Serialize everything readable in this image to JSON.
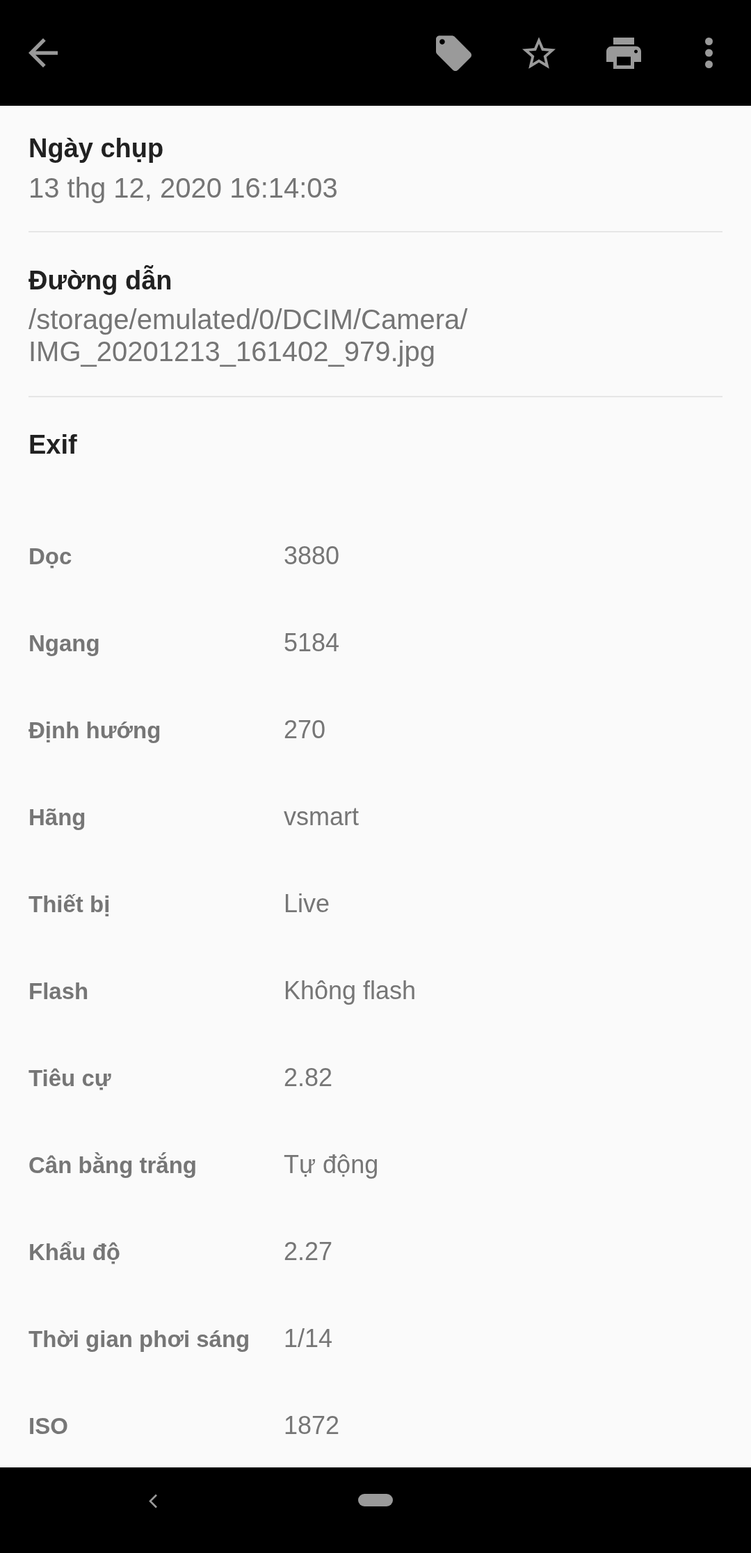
{
  "toolbar": {
    "favorite": false
  },
  "details": [
    {
      "title": "Ngày chụp",
      "value": "13 thg 12, 2020 16:14:03"
    },
    {
      "title": "Đường dẫn",
      "value": "/storage/emulated/0/DCIM/Camera/IMG_20201213_161402_979.jpg"
    }
  ],
  "exif": {
    "title": "Exif",
    "rows": [
      {
        "label": "Dọc",
        "value": "3880"
      },
      {
        "label": "Ngang",
        "value": "5184"
      },
      {
        "label": "Định hướng",
        "value": "270"
      },
      {
        "label": "Hãng",
        "value": "vsmart"
      },
      {
        "label": "Thiết bị",
        "value": "Live"
      },
      {
        "label": "Flash",
        "value": "Không flash"
      },
      {
        "label": "Tiêu cự",
        "value": "2.82"
      },
      {
        "label": "Cân bằng trắng",
        "value": "Tự động"
      },
      {
        "label": "Khẩu độ",
        "value": "2.27"
      },
      {
        "label": "Thời gian phơi sáng",
        "value": "1/14"
      },
      {
        "label": "ISO",
        "value": "1872"
      }
    ]
  }
}
